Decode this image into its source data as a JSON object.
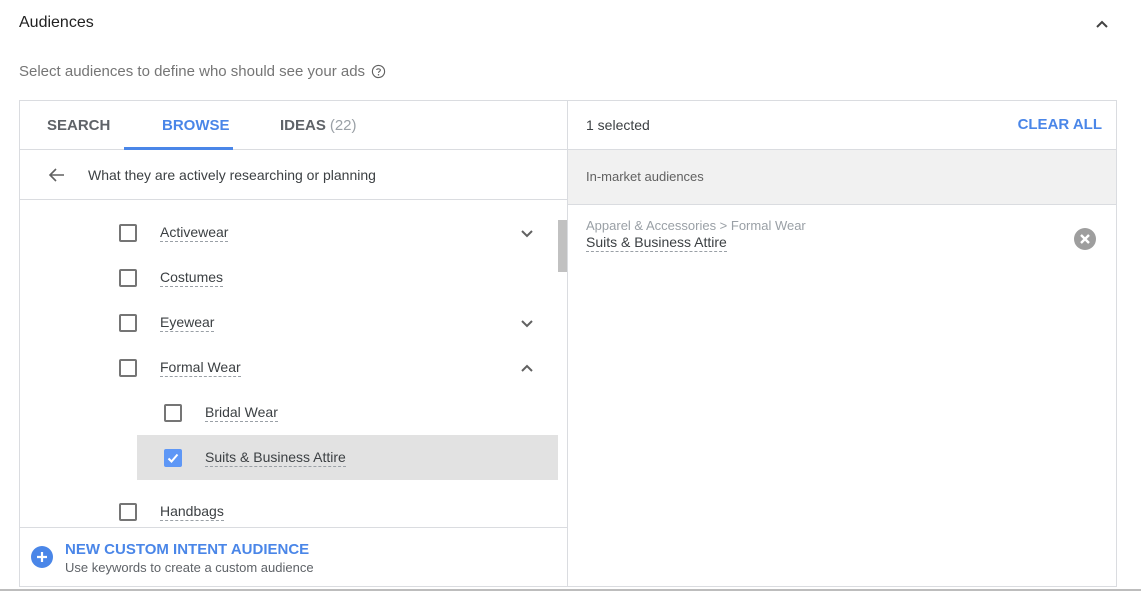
{
  "section": {
    "title": "Audiences",
    "subtitle": "Select audiences to define who should see your ads",
    "collapse_icon": "chevron-up-icon",
    "help_icon": "help-circle-icon"
  },
  "tabs": [
    {
      "label": "SEARCH",
      "active": false
    },
    {
      "label": "BROWSE",
      "active": true
    },
    {
      "label": "IDEAS",
      "count": "(22)",
      "active": false
    }
  ],
  "browse": {
    "back_icon": "arrow-left-icon",
    "breadcrumb": "What they are actively researching or planning",
    "items": [
      {
        "label": "Activewear",
        "checked": false,
        "level": 1,
        "expander": "chevron-down"
      },
      {
        "label": "Costumes",
        "checked": false,
        "level": 1,
        "expander": null
      },
      {
        "label": "Eyewear",
        "checked": false,
        "level": 1,
        "expander": "chevron-down"
      },
      {
        "label": "Formal Wear",
        "checked": false,
        "level": 1,
        "expander": "chevron-up"
      },
      {
        "label": "Bridal Wear",
        "checked": false,
        "level": 2,
        "expander": null
      },
      {
        "label": "Suits & Business Attire",
        "checked": true,
        "level": 2,
        "expander": null
      },
      {
        "label": "Handbags",
        "checked": false,
        "level": 1,
        "expander": null
      }
    ]
  },
  "footer": {
    "icon": "add-circle-icon",
    "title": "NEW CUSTOM INTENT AUDIENCE",
    "subtitle": "Use keywords to create a custom audience"
  },
  "selection": {
    "count_label": "1 selected",
    "clear_all_label": "CLEAR ALL",
    "groups": [
      {
        "label": "In-market audiences",
        "items": [
          {
            "path": "Apparel & Accessories > Formal Wear",
            "name": "Suits & Business Attire",
            "remove_icon": "close-circle-icon"
          }
        ]
      }
    ]
  },
  "colors": {
    "accent": "#4a86e8",
    "checkbox_checked": "#5e97f6",
    "selected_row": "#e2e2e2",
    "group_header_bg": "#f1f1f1"
  }
}
